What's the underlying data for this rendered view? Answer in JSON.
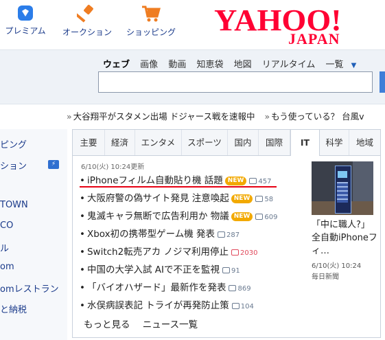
{
  "header": {
    "services": [
      {
        "label": "プレミアム",
        "icon": "premium-diamond-icon"
      },
      {
        "label": "オークション",
        "icon": "auction-gavel-icon"
      },
      {
        "label": "ショッピング",
        "icon": "shopping-cart-icon"
      }
    ],
    "logo": {
      "main": "YAHOO!",
      "sub": "JAPAN",
      "color": "#ff0033"
    }
  },
  "search": {
    "tabs": [
      "ウェブ",
      "画像",
      "動画",
      "知恵袋",
      "地図",
      "リアルタイム",
      "一覧"
    ],
    "active_tab": "ウェブ",
    "query": "",
    "accent": "#3f7ed8"
  },
  "ticker": {
    "items": [
      "大谷翔平がスタメン出場 ドジャース戦を速報中",
      "もう使っている？ 台風v"
    ]
  },
  "sidebar": {
    "items": [
      "ピング",
      "ション",
      "TOWN",
      "CO",
      "ル",
      "om",
      "omレストラン",
      "と納税"
    ]
  },
  "news": {
    "tabs": [
      "主要",
      "経済",
      "エンタメ",
      "スポーツ",
      "国内",
      "国際",
      "IT",
      "科学",
      "地域"
    ],
    "active_tab": "IT",
    "updated": "6/10(火) 10:24更新",
    "items": [
      {
        "title": "iPhoneフィルム自動貼り機 話題",
        "badge": "NEW",
        "comments": "457",
        "hot": false
      },
      {
        "title": "大阪府警の偽サイト発見 注意喚起",
        "badge": "NEW",
        "comments": "58",
        "hot": false
      },
      {
        "title": "鬼滅キャラ無断で広告利用か 物議",
        "badge": "NEW",
        "comments": "609",
        "hot": false
      },
      {
        "title": "Xbox初の携帯型ゲーム機 発表",
        "badge": "",
        "comments": "287",
        "hot": false
      },
      {
        "title": "Switch2転売アカ ノジマ利用停止",
        "badge": "",
        "comments": "2030",
        "hot": true
      },
      {
        "title": "中国の大学入試 AIで不正を監視",
        "badge": "",
        "comments": "91",
        "hot": false
      },
      {
        "title": "「バイオハザード」最新作を発表",
        "badge": "",
        "comments": "869",
        "hot": false
      },
      {
        "title": "水俣病誤表記 トライが再発防止策",
        "badge": "",
        "comments": "104",
        "hot": false
      }
    ],
    "more": "もっと見る",
    "list": "ニュース一覧",
    "feature": {
      "caption": "「中に職人?」全自動iPhoneフィ…",
      "date": "6/10(火) 10:24",
      "source": "毎日新聞"
    }
  },
  "colors": {
    "highlight_underline": "#e60012",
    "new_badge": "#f2a900"
  }
}
